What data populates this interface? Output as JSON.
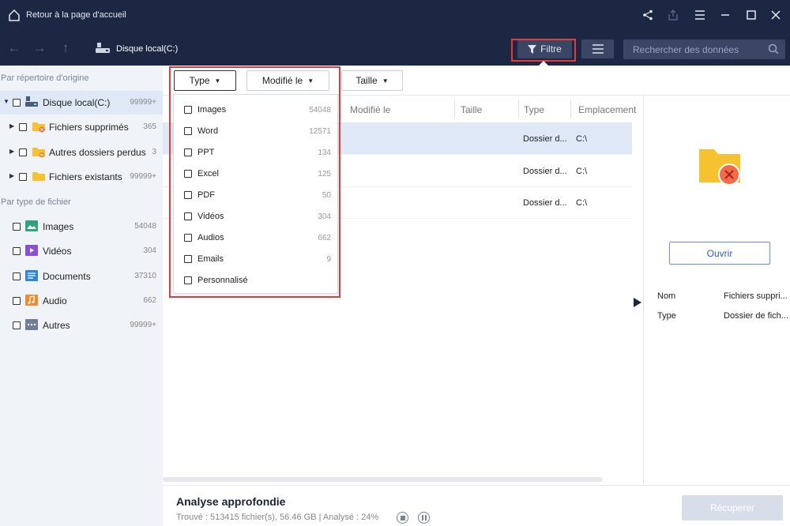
{
  "titlebar": {
    "home_label": "Retour à la page d'accueil"
  },
  "toolbar": {
    "path": "Disque local(C:)",
    "filter_label": "Filtre",
    "search_placeholder": "Rechercher des données"
  },
  "sidebar": {
    "section_origin": "Par répertoire d'origine",
    "root": {
      "label": "Disque local(C:)",
      "count": "99999+"
    },
    "folders": [
      {
        "label": "Fichiers supprimés",
        "count": "365",
        "icon": "folder-deleted-icon"
      },
      {
        "label": "Autres dossiers perdus",
        "count": "3",
        "icon": "folder-lost-icon"
      },
      {
        "label": "Fichiers existants",
        "count": "99999+",
        "icon": "folder-icon"
      }
    ],
    "section_type": "Par type de fichier",
    "types": [
      {
        "label": "Images",
        "count": "54048",
        "icon": "image-type-icon",
        "color": "#2fa37a"
      },
      {
        "label": "Vidéos",
        "count": "304",
        "icon": "video-type-icon",
        "color": "#8a4fd3"
      },
      {
        "label": "Documents",
        "count": "37310",
        "icon": "document-type-icon",
        "color": "#2f86d6"
      },
      {
        "label": "Audio",
        "count": "662",
        "icon": "audio-type-icon",
        "color": "#f08a2c"
      },
      {
        "label": "Autres",
        "count": "99999+",
        "icon": "other-type-icon",
        "color": "#6f7d96"
      }
    ]
  },
  "filters": {
    "type": "Type",
    "modified": "Modifié le",
    "size": "Taille"
  },
  "type_dropdown": [
    {
      "label": "Images",
      "count": "54048"
    },
    {
      "label": "Word",
      "count": "12571"
    },
    {
      "label": "PPT",
      "count": "134"
    },
    {
      "label": "Excel",
      "count": "125"
    },
    {
      "label": "PDF",
      "count": "50"
    },
    {
      "label": "Vidéos",
      "count": "304"
    },
    {
      "label": "Audios",
      "count": "662"
    },
    {
      "label": "Emails",
      "count": "9"
    },
    {
      "label": "Personnalisé",
      "count": ""
    }
  ],
  "table": {
    "columns": {
      "modified": "Modifié le",
      "size": "Taille",
      "type": "Type",
      "location": "Emplacement"
    },
    "rows": [
      {
        "type": "Dossier d...",
        "location": "C:\\"
      },
      {
        "type": "Dossier d...",
        "location": "C:\\"
      },
      {
        "type": "Dossier d...",
        "location": "C:\\"
      }
    ]
  },
  "details": {
    "open_label": "Ouvrir",
    "name_key": "Nom",
    "name_value": "Fichiers suppri...",
    "type_key": "Type",
    "type_value": "Dossier de fich..."
  },
  "status": {
    "title": "Analyse approfondie",
    "stats": "Trouvé : 513415 fichier(s), 56.46 GB | Analysé : 24%",
    "recover_label": "Récuperer"
  },
  "colors": {
    "header": "#1c2743",
    "highlight": "#e23b3b",
    "selection": "#dfe8f7"
  }
}
